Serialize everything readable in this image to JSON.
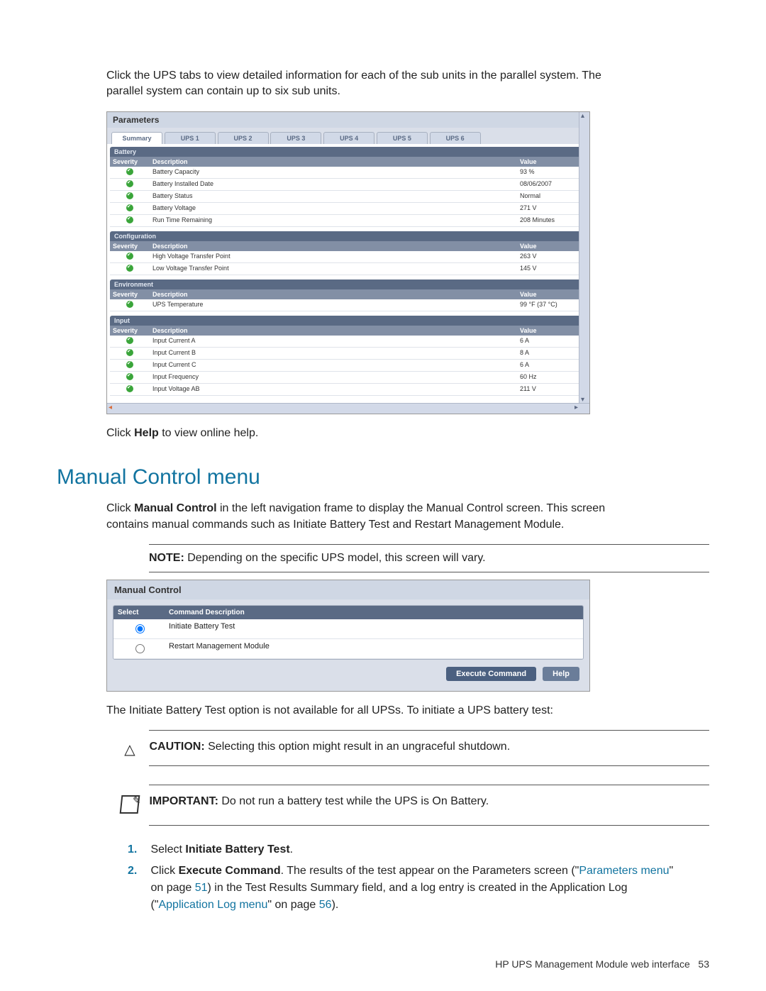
{
  "intro_text_a": "Click the UPS tabs to view detailed information for each of the sub units in the parallel system. The ",
  "intro_text_b": "parallel system can contain up to six sub units.",
  "parameters": {
    "title": "Parameters",
    "tabs": [
      "Summary",
      "UPS 1",
      "UPS 2",
      "UPS 3",
      "UPS 4",
      "UPS 5",
      "UPS 6"
    ],
    "columns": {
      "severity": "Severity",
      "description": "Description",
      "value": "Value"
    },
    "groups": [
      {
        "title": "Battery",
        "rows": [
          {
            "desc": "Battery Capacity",
            "val": "93 %"
          },
          {
            "desc": "Battery Installed Date",
            "val": "08/06/2007"
          },
          {
            "desc": "Battery Status",
            "val": "Normal"
          },
          {
            "desc": "Battery Voltage",
            "val": "271 V"
          },
          {
            "desc": "Run Time Remaining",
            "val": "208 Minutes"
          }
        ]
      },
      {
        "title": "Configuration",
        "rows": [
          {
            "desc": "High Voltage Transfer Point",
            "val": "263 V"
          },
          {
            "desc": "Low Voltage Transfer Point",
            "val": "145 V"
          }
        ]
      },
      {
        "title": "Environment",
        "rows": [
          {
            "desc": "UPS Temperature",
            "val": "99 °F (37 °C)"
          }
        ]
      },
      {
        "title": "Input",
        "rows": [
          {
            "desc": "Input Current A",
            "val": "6 A"
          },
          {
            "desc": "Input Current B",
            "val": "8 A"
          },
          {
            "desc": "Input Current C",
            "val": "6 A"
          },
          {
            "desc": "Input Frequency",
            "val": "60 Hz"
          },
          {
            "desc": "Input Voltage AB",
            "val": "211 V"
          }
        ]
      }
    ]
  },
  "help_text_a": "Click ",
  "help_text_bold": "Help",
  "help_text_b": " to view online help.",
  "section_heading": "Manual Control menu",
  "section_body_a": "Click ",
  "section_body_bold": "Manual Control",
  "section_body_b": " in the left navigation frame to display the Manual Control screen. This screen ",
  "section_body_c": "contains manual commands such as Initiate Battery Test and Restart Management Module.",
  "note_label": "NOTE:",
  "note_text": "  Depending on the specific UPS model, this screen will vary.",
  "manual": {
    "title": "Manual Control",
    "columns": {
      "select": "Select",
      "desc": "Command Description"
    },
    "rows": [
      {
        "selected": true,
        "desc": "Initiate Battery Test"
      },
      {
        "selected": false,
        "desc": "Restart Management Module"
      }
    ],
    "exec_btn": "Execute Command",
    "help_btn": "Help"
  },
  "after_manual": "The Initiate Battery Test option is not available for all UPSs. To initiate a UPS battery test:",
  "caution_label": "CAUTION:",
  "caution_text": "  Selecting this option might result in an ungraceful shutdown.",
  "important_label": "IMPORTANT:",
  "important_text": "  Do not run a battery test while the UPS is On Battery.",
  "step1_a": "Select ",
  "step1_bold": "Initiate Battery Test",
  "step1_b": ".",
  "step2_a": "Click ",
  "step2_bold": "Execute Command",
  "step2_b": ". The results of the test appear on the Parameters screen (\"",
  "step2_link1": "Parameters menu",
  "step2_c": "\" on page ",
  "step2_link2": "51",
  "step2_d": ") in the Test Results Summary field, and a log entry is created in the Application Log (\"",
  "step2_link3": "Application Log menu",
  "step2_e": "\" on page ",
  "step2_link4": "56",
  "step2_f": ").",
  "footer_text": "HP UPS Management Module web interface",
  "footer_page": "53"
}
